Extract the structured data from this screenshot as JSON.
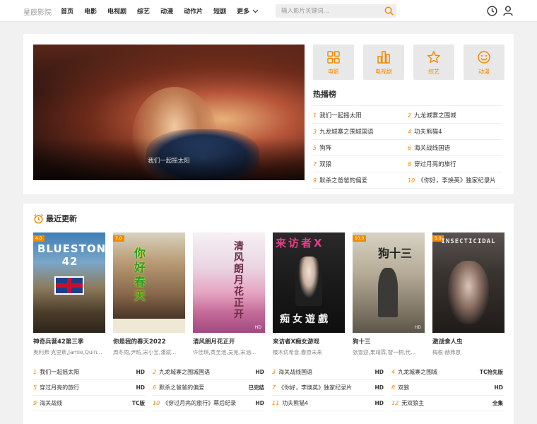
{
  "header": {
    "logo": "星辰影院",
    "nav": [
      "首页",
      "电影",
      "电视剧",
      "综艺",
      "动漫",
      "动作片",
      "短剧"
    ],
    "more": "更多",
    "search_placeholder": "输入影片关键词..."
  },
  "banner": {
    "caption": "我们一起摇太阳"
  },
  "categories": [
    {
      "label": "电影",
      "icon": "grid-icon"
    },
    {
      "label": "电视剧",
      "icon": "bar-chart-icon"
    },
    {
      "label": "综艺",
      "icon": "star-icon"
    },
    {
      "label": "动漫",
      "icon": "smile-icon"
    }
  ],
  "hot": {
    "title": "热播榜",
    "items": [
      {
        "num": "1",
        "title": "我们一起摇太阳"
      },
      {
        "num": "2",
        "title": "九龙城寨之围城"
      },
      {
        "num": "3",
        "title": "九龙城寨之围城国语"
      },
      {
        "num": "4",
        "title": "功夫熊猫4"
      },
      {
        "num": "5",
        "title": "狗阵"
      },
      {
        "num": "6",
        "title": "海关战线国语"
      },
      {
        "num": "7",
        "title": "双狼"
      },
      {
        "num": "8",
        "title": "穿过月亮的旅行"
      },
      {
        "num": "9",
        "title": "默杀之爸爸的偏爱"
      },
      {
        "num": "10",
        "title": "《你好，李焕英》独家纪录片"
      }
    ]
  },
  "recent": {
    "title": "最近更新",
    "posters": [
      {
        "badge": "4.0",
        "poster_text": "BLUESTONE 42",
        "title": "神奇兵营42第三季",
        "cast": "奥利弗·克里斯,Jamie,Quin..."
      },
      {
        "badge": "7.0",
        "poster_text": "你好春天",
        "title": "你是我的春天2022",
        "cast": "周冬雨,尹昉,宋小宝,潘斌..."
      },
      {
        "badge": "",
        "poster_text": "清风朗月花正开",
        "title": "清风朗月花正开",
        "cast": "许佳琪,黄圣池,吴羌,宋涵..."
      },
      {
        "badge": "",
        "poster_text": "来访者X",
        "title": "来访者X痴女游戏",
        "cast": "樱木优希音,春原未来"
      },
      {
        "badge": "10.0",
        "poster_text": "狗十三",
        "title": "狗十三",
        "cast": "张雪迎,果靖霖,智一桐,代..."
      },
      {
        "badge": "5.0",
        "poster_text": "INSECTICIDAL",
        "title": "激战食人虫",
        "cast": "梅根·赫弗恩"
      }
    ],
    "items": [
      {
        "num": "1",
        "title": "我们一起摇太阳",
        "status": "HD"
      },
      {
        "num": "2",
        "title": "九龙城寨之围城国语",
        "status": "HD"
      },
      {
        "num": "3",
        "title": "海关战线国语",
        "status": "HD"
      },
      {
        "num": "4",
        "title": "九龙城寨之围城",
        "status": "TC抢先版"
      },
      {
        "num": "5",
        "title": "穿过月亮的旅行",
        "status": "HD"
      },
      {
        "num": "6",
        "title": "默杀之爸爸的偏爱",
        "status": "已完结"
      },
      {
        "num": "7",
        "title": "《你好，李焕英》独家纪录片",
        "status": "HD"
      },
      {
        "num": "8",
        "title": "双狼",
        "status": "HD"
      },
      {
        "num": "9",
        "title": "海关战线",
        "status": "TC版"
      },
      {
        "num": "10",
        "title": "《穿过月亮的旅行》幕后纪录",
        "status": "HD"
      },
      {
        "num": "11",
        "title": "功夫熊猫4",
        "status": "HD"
      },
      {
        "num": "12",
        "title": "无双狼主",
        "status": "全集"
      }
    ]
  },
  "colors": {
    "accent": "#f08a00",
    "panel": "#ffffff",
    "background": "#f1f1f1"
  }
}
